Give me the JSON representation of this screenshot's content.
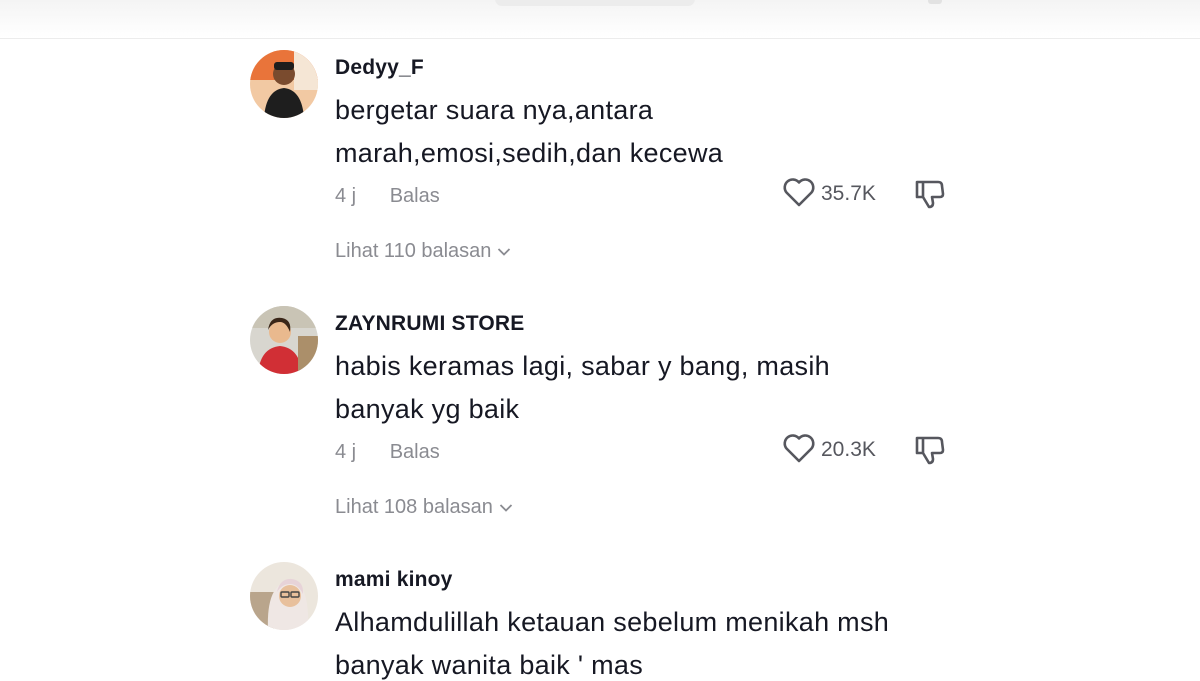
{
  "comments": [
    {
      "username": "Dedyy_F",
      "lines": [
        "bergetar suara nya,antara",
        "marah,emosi,sedih,dan kecewa"
      ],
      "time": "4 j",
      "reply_label": "Balas",
      "likes": "35.7K",
      "view_replies": "Lihat 110 balasan"
    },
    {
      "username": "ZAYNRUMI STORE",
      "lines": [
        "habis keramas lagi, sabar y bang, masih",
        "banyak yg baik"
      ],
      "time": "4 j",
      "reply_label": "Balas",
      "likes": "20.3K",
      "view_replies": "Lihat 108 balasan"
    },
    {
      "username": "mami kinoy",
      "lines": [
        "Alhamdulillah ketauan sebelum menikah msh",
        "banyak wanita baik ' mas"
      ]
    }
  ],
  "icons": {
    "like": "heart-outline-icon",
    "dislike": "thumbs-down-icon",
    "expand": "chevron-down-icon"
  },
  "colors": {
    "text_primary": "#161823",
    "text_secondary": "#8a8b91",
    "icon": "#56575e"
  }
}
